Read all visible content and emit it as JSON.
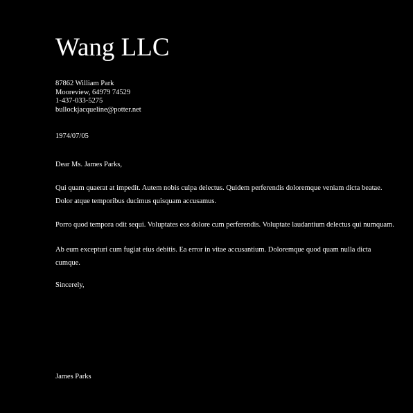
{
  "letterhead": {
    "company": "Wang LLC",
    "address": [
      "87862 William Park",
      "Mooreview, 64979 74529",
      "1-437-033-5275",
      "bullockjacqueline@potter.net"
    ]
  },
  "date": "1974/07/05",
  "salutation": "Dear Ms. James Parks,",
  "body": [
    "Qui quam quaerat at impedit. Autem nobis culpa delectus. Quidem perferendis doloremque veniam dicta beatae. Dolor atque temporibus ducimus quisquam accusamus.",
    "Porro quod tempora odit sequi. Voluptates eos dolore cum perferendis. Voluptate laudantium delectus qui numquam.",
    "Ab eum excepturi cum fugiat eius debitis. Ea error in vitae accusantium. Doloremque quod quam nulla dicta cumque."
  ],
  "closing": "Sincerely,",
  "signature": "James Parks",
  "colors": {
    "background": "#000000",
    "text": "#ffffff"
  }
}
